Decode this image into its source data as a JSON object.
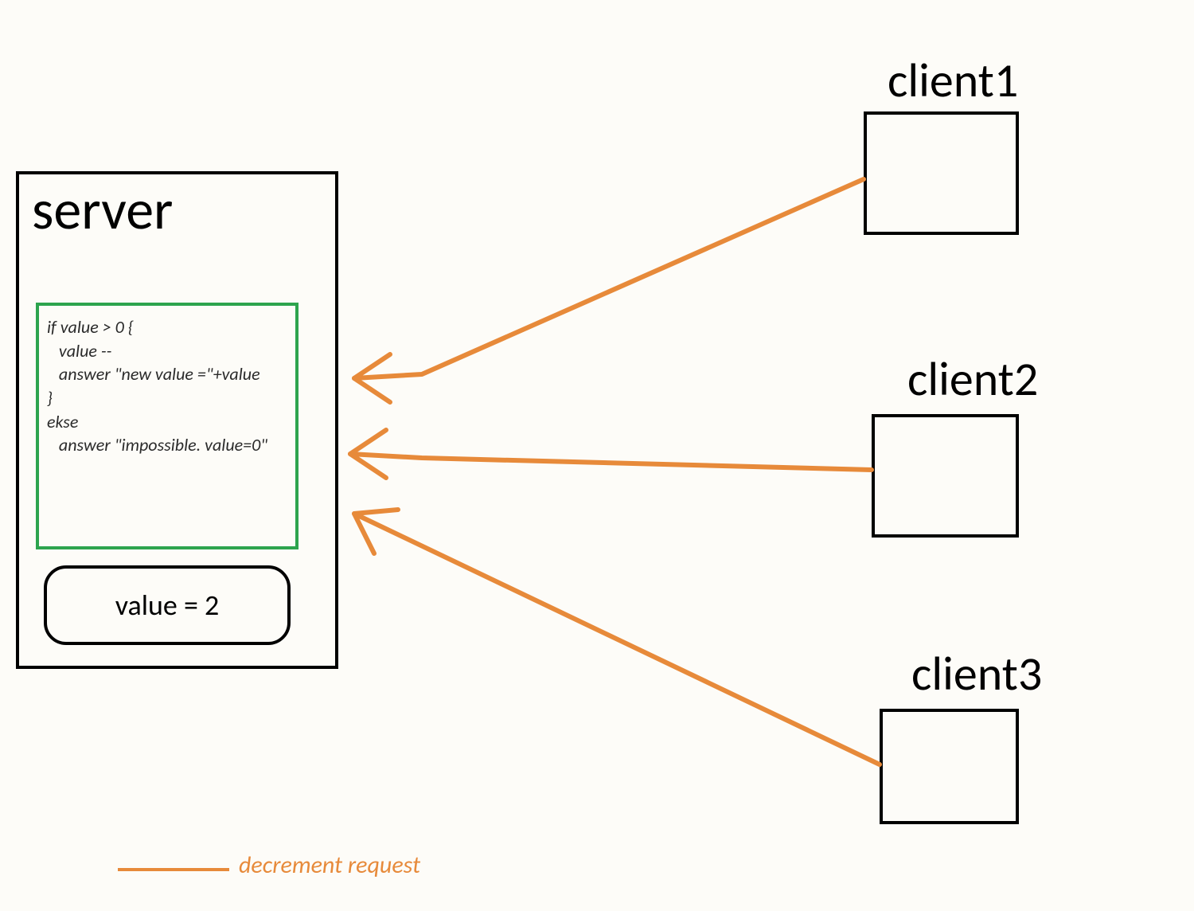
{
  "server": {
    "label": "server",
    "code": "if value > 0 {\n   value --\n   answer \"new value =\"+value\n}\nekse\n   answer \"impossible. value=0\"",
    "value_label": "value = 2"
  },
  "clients": {
    "client1": "client1",
    "client2": "client2",
    "client3": "client3"
  },
  "legend": {
    "label": "decrement request"
  }
}
